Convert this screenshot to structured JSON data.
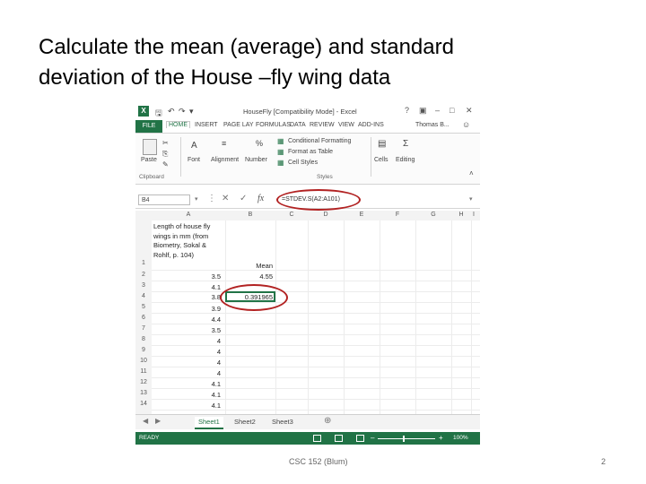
{
  "slide": {
    "title_line1": "Calculate the mean (average) and standard",
    "title_line2": "deviation of the House –fly wing data",
    "footer": "CSC 152 (Blum)",
    "page_number": "2"
  },
  "excel": {
    "window_title": "HouseFly [Compatibility Mode] - Excel",
    "user": "Thomas B...",
    "tabs": [
      "FILE",
      "HOME",
      "INSERT",
      "PAGE LAY",
      "FORMULAS",
      "DATA",
      "REVIEW",
      "VIEW",
      "ADD-INS"
    ],
    "ribbon": {
      "paste": "Paste",
      "clipboard": "Clipboard",
      "font": "Font",
      "alignment": "Alignment",
      "number": "Number",
      "conditional_formatting": "Conditional Formatting",
      "format_as_table": "Format as Table",
      "cell_styles": "Cell Styles",
      "styles": "Styles",
      "cells": "Cells",
      "editing": "Editing"
    },
    "name_box": "B4",
    "formula": "=STDEV.S(A2:A101)",
    "columns": [
      "A",
      "B",
      "C",
      "D",
      "E",
      "F",
      "G",
      "H",
      "I"
    ],
    "rows": [
      "1",
      "2",
      "3",
      "4",
      "5",
      "6",
      "7",
      "8",
      "9",
      "10",
      "11",
      "12",
      "13",
      "14"
    ],
    "a1_lines": [
      "Length of house fly",
      "wings in mm (from",
      "Biometry, Sokal &",
      "Rohlf, p. 104)"
    ],
    "b1": "Mean",
    "b2": "4.55",
    "b4": "0.391965",
    "col_a_values": [
      "3.5",
      "4.1",
      "3.8",
      "3.9",
      "4.4",
      "3.5",
      "4",
      "4",
      "4",
      "4",
      "4.1",
      "4.1",
      "4.1"
    ],
    "sheets": [
      "Sheet1",
      "Sheet2",
      "Sheet3"
    ],
    "status": "READY",
    "zoom": "100%"
  }
}
